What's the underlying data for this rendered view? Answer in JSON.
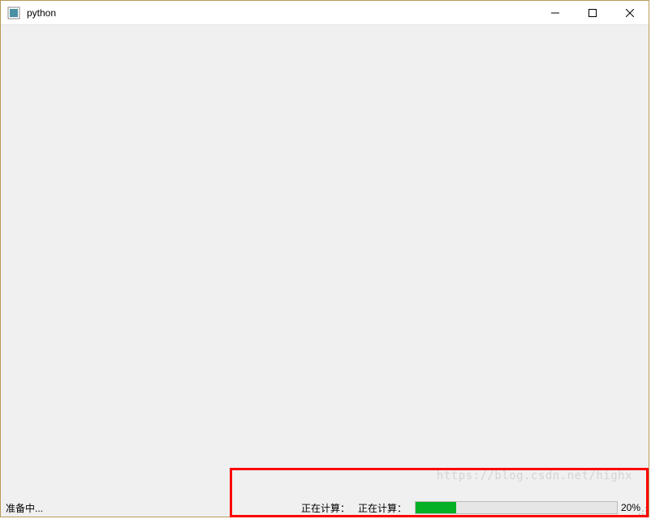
{
  "window": {
    "title": "python"
  },
  "statusbar": {
    "left_text": "准备中...",
    "mid_text_1": "正在计算：",
    "mid_text_2": "正在计算：",
    "progress_percent": 20,
    "progress_label": "20%"
  },
  "watermark": "https://blog.csdn.net/highx"
}
